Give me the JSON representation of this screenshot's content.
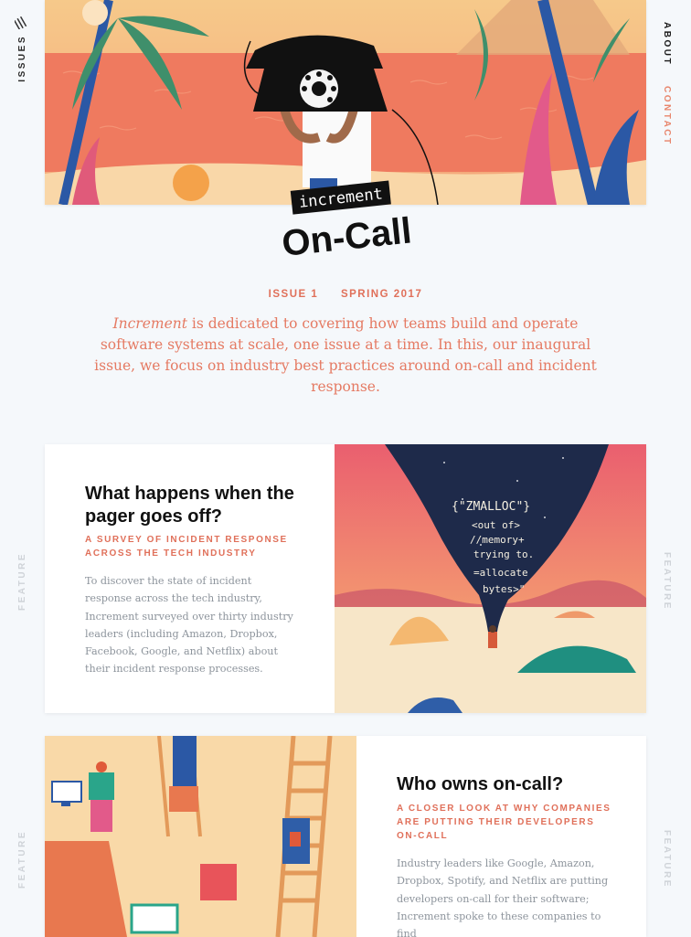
{
  "nav": {
    "issues": "ISSUES",
    "about": "ABOUT",
    "contact": "CONTACT"
  },
  "hero": {
    "logo_top": "increment",
    "logo_main": "On-Call"
  },
  "issue": {
    "number": "ISSUE 1",
    "season": "SPRING 2017"
  },
  "intro": {
    "brand": "Increment",
    "text": " is dedicated to covering how teams build and operate software systems at scale, one issue at a time. In this, our inaugural issue, we focus on industry best practices around on-call and incident response."
  },
  "features": [
    {
      "label": "FEATURE",
      "title": "What happens when the pager goes off?",
      "subtitle": "A survey of incident response across the tech industry",
      "body": "To discover the state of incident response across the tech industry, Increment surveyed over thirty industry leaders (including Amazon, Dropbox, Facebook, Google, and Netflix) about their incident response processes.",
      "art_text": [
        "{\"ZMALLOC\"}",
        "<out of>",
        "//memory+",
        "trying to.",
        "=allocate",
        "bytes>\""
      ]
    },
    {
      "label": "FEATURE",
      "title": "Who owns on-call?",
      "subtitle": "A closer look at why companies are putting their developers on-call",
      "body": "Industry leaders like Google, Amazon, Dropbox, Spotify, and Netflix are putting developers on-call for their software; Increment spoke to these companies to find"
    }
  ]
}
